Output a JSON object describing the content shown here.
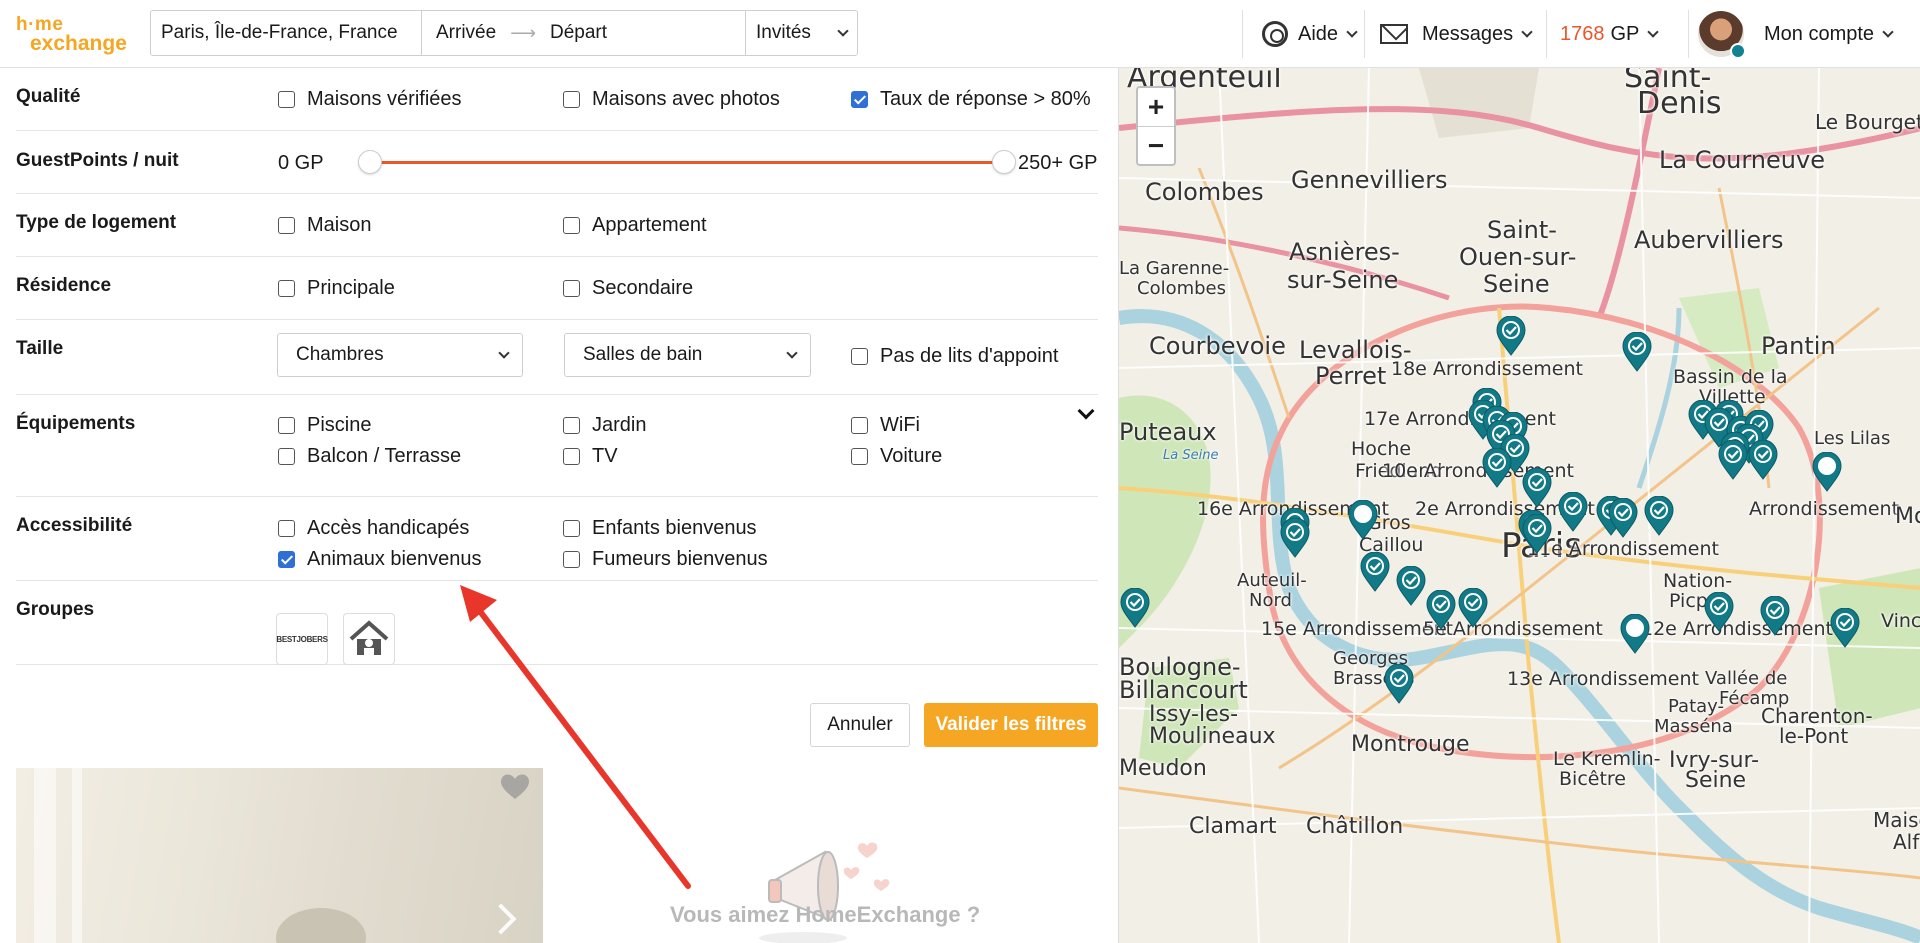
{
  "header": {
    "logo_line1": "h·me",
    "logo_line2": "exchange",
    "destination": "Paris, Île-de-France, France",
    "arrival": "Arrivée",
    "departure": "Départ",
    "guests": "Invités",
    "help": "Aide",
    "messages": "Messages",
    "gp_amount": "1768",
    "gp_unit": "GP",
    "account": "Mon compte"
  },
  "filters": {
    "quality": {
      "label": "Qualité",
      "options": [
        {
          "label": "Maisons vérifiées",
          "checked": false
        },
        {
          "label": "Maisons avec photos",
          "checked": false
        },
        {
          "label": "Taux de réponse > 80%",
          "checked": true
        }
      ]
    },
    "guestpoints": {
      "label": "GuestPoints / nuit",
      "min_label": "0 GP",
      "max_label": "250+ GP"
    },
    "home_type": {
      "label": "Type de logement",
      "options": [
        {
          "label": "Maison",
          "checked": false
        },
        {
          "label": "Appartement",
          "checked": false
        }
      ]
    },
    "residence": {
      "label": "Résidence",
      "options": [
        {
          "label": "Principale",
          "checked": false
        },
        {
          "label": "Secondaire",
          "checked": false
        }
      ]
    },
    "size": {
      "label": "Taille",
      "bedrooms": "Chambres",
      "bathrooms": "Salles de bain",
      "no_extra_beds": "Pas de lits d'appoint"
    },
    "amenities": {
      "label": "Équipements",
      "options": [
        {
          "label": "Piscine",
          "checked": false
        },
        {
          "label": "Jardin",
          "checked": false
        },
        {
          "label": "WiFi",
          "checked": false
        },
        {
          "label": "Balcon / Terrasse",
          "checked": false
        },
        {
          "label": "TV",
          "checked": false
        },
        {
          "label": "Voiture",
          "checked": false
        }
      ]
    },
    "accessibility": {
      "label": "Accessibilité",
      "options": [
        {
          "label": "Accès handicapés",
          "checked": false
        },
        {
          "label": "Enfants bienvenus",
          "checked": false
        },
        {
          "label": "Animaux bienvenus",
          "checked": true
        },
        {
          "label": "Fumeurs bienvenus",
          "checked": false
        }
      ]
    },
    "groups": {
      "label": "Groupes",
      "logo1_text": "BESTJOBERS"
    },
    "cancel": "Annuler",
    "apply": "Valider les filtres"
  },
  "promo": {
    "title": "Vous aimez HomeExchange ?"
  },
  "map": {
    "zoom_in": "+",
    "zoom_out": "−",
    "labels": [
      {
        "text": "Argenteuil"
      },
      {
        "text": "Saint-"
      },
      {
        "text": "Denis"
      },
      {
        "text": "Le Bourget"
      },
      {
        "text": "Colombes"
      },
      {
        "text": "Gennevilliers"
      },
      {
        "text": "La Courneuve"
      },
      {
        "text": "Asnières-"
      },
      {
        "text": "sur-Seine"
      },
      {
        "text": "Saint-"
      },
      {
        "text": "Ouen-sur-"
      },
      {
        "text": "Seine"
      },
      {
        "text": "Aubervilliers"
      },
      {
        "text": "La Garenne-"
      },
      {
        "text": "Colombes"
      },
      {
        "text": "Courbevoie"
      },
      {
        "text": "Levallois-"
      },
      {
        "text": "Perret"
      },
      {
        "text": "Pantin"
      },
      {
        "text": "18e Arrondissement"
      },
      {
        "text": "Bassin de la"
      },
      {
        "text": "Villette"
      },
      {
        "text": "17e Arrondissement"
      },
      {
        "text": "Puteaux"
      },
      {
        "text": "Hoche"
      },
      {
        "text": "Friedland"
      },
      {
        "text": "10e Arrondissement"
      },
      {
        "text": "Les Lilas"
      },
      {
        "text": "16e Arrondissement"
      },
      {
        "text": "2e Arrondissement"
      },
      {
        "text": "Arrondissement"
      },
      {
        "text": "Paris"
      },
      {
        "text": "11e Arrondissement"
      },
      {
        "text": "Gros"
      },
      {
        "text": "Caillou"
      },
      {
        "text": "Auteuil-"
      },
      {
        "text": "Nord"
      },
      {
        "text": "Nation-"
      },
      {
        "text": "Picpus"
      },
      {
        "text": "Boulogne-"
      },
      {
        "text": "Billancourt"
      },
      {
        "text": "15e Arrondissement"
      },
      {
        "text": "5e Arrondissement"
      },
      {
        "text": "12e Arrondissement"
      },
      {
        "text": "Vincennes"
      },
      {
        "text": "Georges"
      },
      {
        "text": "Brassens"
      },
      {
        "text": "13e Arrondissement"
      },
      {
        "text": "Vallée de"
      },
      {
        "text": "Fécamp"
      },
      {
        "text": "Issy-les-"
      },
      {
        "text": "Moulineaux"
      },
      {
        "text": "Patay-"
      },
      {
        "text": "Masséna"
      },
      {
        "text": "Charenton-"
      },
      {
        "text": "le-Pont"
      },
      {
        "text": "Meudon"
      },
      {
        "text": "Montrouge"
      },
      {
        "text": "Le Kremlin-"
      },
      {
        "text": "Bicêtre"
      },
      {
        "text": "Ivry-sur-"
      },
      {
        "text": "Seine"
      },
      {
        "text": "Clamart"
      },
      {
        "text": "Châtillon"
      },
      {
        "text": "Maisons-"
      },
      {
        "text": "Alfort"
      },
      {
        "text": "La Seine"
      },
      {
        "text": "Montreuil"
      }
    ]
  }
}
